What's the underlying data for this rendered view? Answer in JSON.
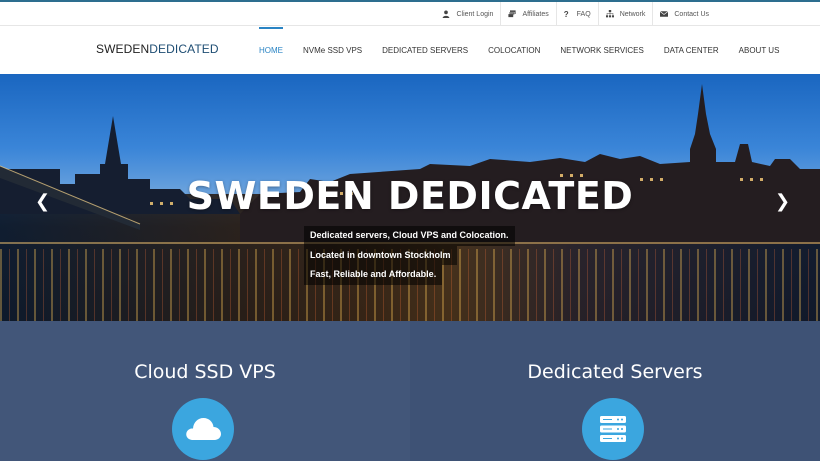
{
  "topbar": {
    "links": [
      {
        "label": "Client Login",
        "icon": "user-icon"
      },
      {
        "label": "Affiliates",
        "icon": "money-icon"
      },
      {
        "label": "FAQ",
        "icon": "question-icon"
      },
      {
        "label": "Network",
        "icon": "sitemap-icon"
      },
      {
        "label": "Contact Us",
        "icon": "envelope-icon"
      }
    ]
  },
  "logo": {
    "part1": "SWEDEN",
    "part2": "DEDICATED"
  },
  "nav": {
    "items": [
      {
        "label": "HOME",
        "active": true
      },
      {
        "label": "NVMe SSD VPS"
      },
      {
        "label": "DEDICATED SERVERS"
      },
      {
        "label": "COLOCATION"
      },
      {
        "label": "NETWORK SERVICES"
      },
      {
        "label": "DATA CENTER"
      },
      {
        "label": "ABOUT US"
      }
    ]
  },
  "hero": {
    "title": "SWEDEN DEDICATED",
    "lines": [
      "Dedicated servers, Cloud VPS and Colocation.",
      "Located in downtown Stockholm",
      "Fast, Reliable and Affordable."
    ],
    "prev_icon": "chevron-left-icon",
    "next_icon": "chevron-right-icon"
  },
  "panels": [
    {
      "title": "Cloud SSD VPS",
      "icon": "cloud-icon"
    },
    {
      "title": "Dedicated Servers",
      "icon": "server-icon"
    }
  ],
  "colors": {
    "accent": "#2a84c4",
    "brand_dark": "#1e4d73",
    "panel_bg": "#425679",
    "icon_circle": "#3ba6df"
  }
}
